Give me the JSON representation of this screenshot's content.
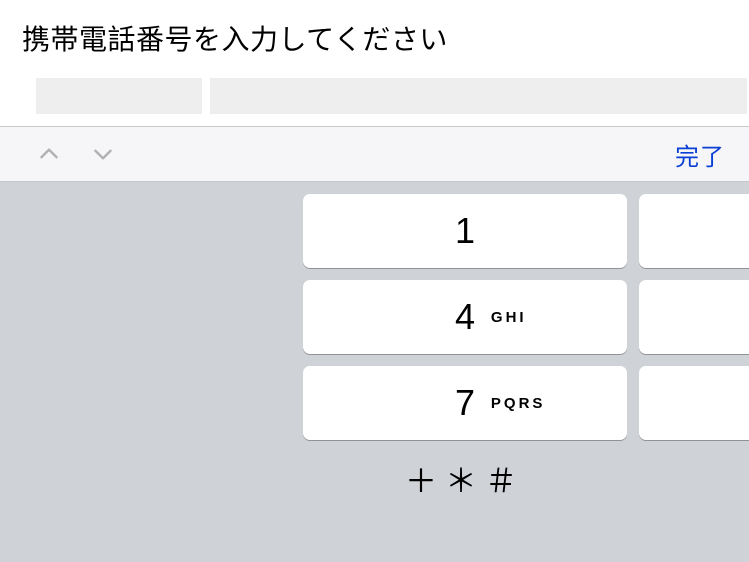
{
  "header": {
    "title": "携帯電話番号を入力してください"
  },
  "toolbar": {
    "done_label": "完了"
  },
  "keypad": {
    "row1": {
      "digit": "1",
      "letters": ""
    },
    "row2": {
      "digit": "4",
      "letters": "GHI"
    },
    "row3": {
      "digit": "7",
      "letters": "PQRS"
    },
    "symbols": "＋＊＃"
  }
}
